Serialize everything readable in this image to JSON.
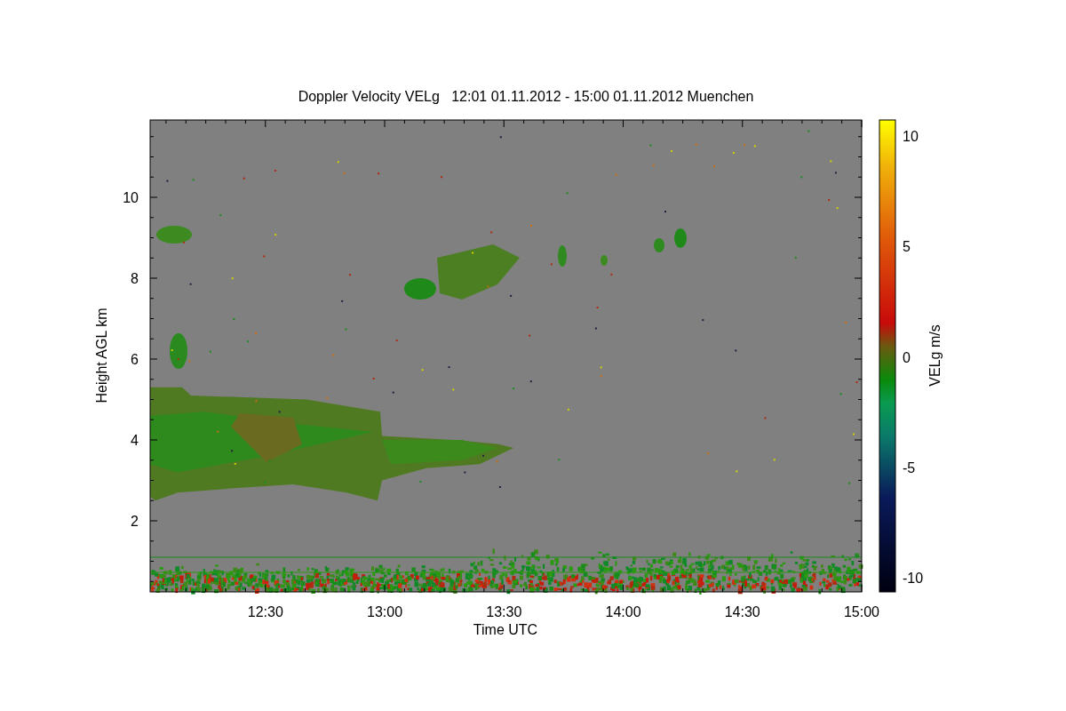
{
  "title": "Doppler Velocity VELg   12:01 01.11.2012 - 15:00 01.11.2012 Muenchen",
  "x_axis": {
    "label": "Time UTC",
    "ticks": [
      "12:30",
      "13:00",
      "13:30",
      "14:00",
      "14:30",
      "15:00"
    ]
  },
  "y_axis": {
    "label": "Height AGL km",
    "ticks": [
      "10",
      "8",
      "6",
      "4",
      "2"
    ]
  },
  "colorbar": {
    "label": "VELg m/s",
    "ticks": [
      "10",
      "5",
      "0",
      "-5",
      "-10"
    ]
  }
}
